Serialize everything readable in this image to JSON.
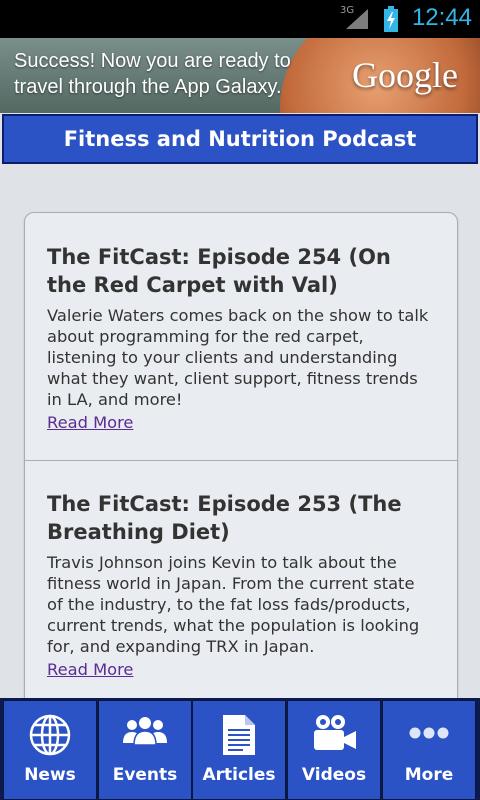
{
  "status_bar": {
    "network": "3G",
    "time": "12:44"
  },
  "ad": {
    "text": "Success! Now you are ready to travel through the App Galaxy.",
    "brand": "Google"
  },
  "header": {
    "title": "Fitness and Nutrition Podcast"
  },
  "episodes": [
    {
      "title": "The FitCast: Episode 254 (On the Red Carpet with Val)",
      "description": "Valerie Waters comes back on the show to talk about programming for the red carpet, listening to your clients and understanding what they want, client support, fitness trends in LA, and more!",
      "link": "Read More"
    },
    {
      "title": "The FitCast: Episode 253 (The Breathing Diet)",
      "description": "Travis Johnson joins Kevin to talk about the fitness world in Japan. From the current state of the industry, to the fat loss fads/products, current trends, what the population is looking for, and expanding TRX in Japan.",
      "link": "Read More"
    }
  ],
  "tabs": [
    {
      "label": "News",
      "icon": "globe-icon"
    },
    {
      "label": "Events",
      "icon": "people-icon"
    },
    {
      "label": "Articles",
      "icon": "document-icon"
    },
    {
      "label": "Videos",
      "icon": "video-camera-icon"
    },
    {
      "label": "More",
      "icon": "more-dots-icon"
    }
  ],
  "colors": {
    "header_bg": "#2b53c6",
    "status_accent": "#33b5e5",
    "link": "#5b2c91",
    "page_bg": "#dfe3e8"
  }
}
